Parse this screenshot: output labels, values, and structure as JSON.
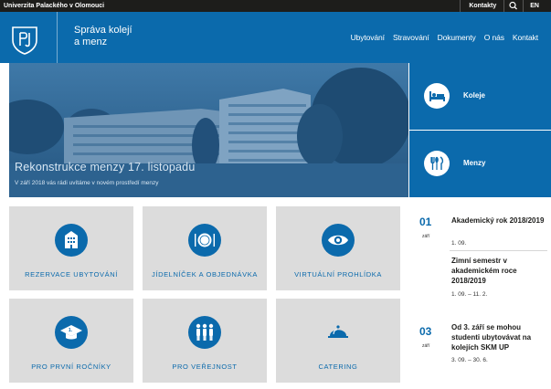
{
  "topbar": {
    "university": "Univerzita Palackého v Olomouci",
    "contact": "Kontakty",
    "lang": "EN"
  },
  "header": {
    "brand_line1": "Správa kolejí",
    "brand_line2": "a menz",
    "nav": [
      "Ubytování",
      "Stravování",
      "Dokumenty",
      "O nás",
      "Kontakt"
    ]
  },
  "hero": {
    "title": "Rekonstrukce menzy 17. listopadu",
    "subtitle": "V září 2018 vás rádi uvítáme v novém prostředí menzy"
  },
  "side": [
    {
      "label": "Koleje",
      "icon": "bed-icon"
    },
    {
      "label": "Menzy",
      "icon": "cutlery-icon"
    }
  ],
  "tiles": [
    {
      "label": "REZERVACE UBYTOVÁNÍ",
      "icon": "building-icon"
    },
    {
      "label": "JÍDELNÍČEK A OBJEDNÁVKA",
      "icon": "plate-icon"
    },
    {
      "label": "VIRTUÁLNÍ PROHLÍDKA",
      "icon": "eye-icon"
    },
    {
      "label": "PRO PRVNÍ ROČNÍKY",
      "icon": "graduation-icon"
    },
    {
      "label": "PRO VEŘEJNOST",
      "icon": "people-icon"
    },
    {
      "label": "CATERING",
      "icon": "cloche-icon"
    }
  ],
  "news": [
    {
      "day": "01",
      "month": "září",
      "items": [
        {
          "title": "Akademický rok 2018/2019",
          "date": "1. 09."
        },
        {
          "title": "Zimní semestr v akademickém roce 2018/2019",
          "date": "1. 09. – 11. 2."
        }
      ]
    },
    {
      "day": "03",
      "month": "září",
      "items": [
        {
          "title": "Od 3. září se mohou studenti ubytovávat na kolejích SKM UP",
          "date": "3. 09. – 30. 6."
        }
      ]
    }
  ],
  "colors": {
    "brand": "#0b6aac",
    "tile": "#dcdcdc",
    "topbar": "#1d1d1b"
  }
}
